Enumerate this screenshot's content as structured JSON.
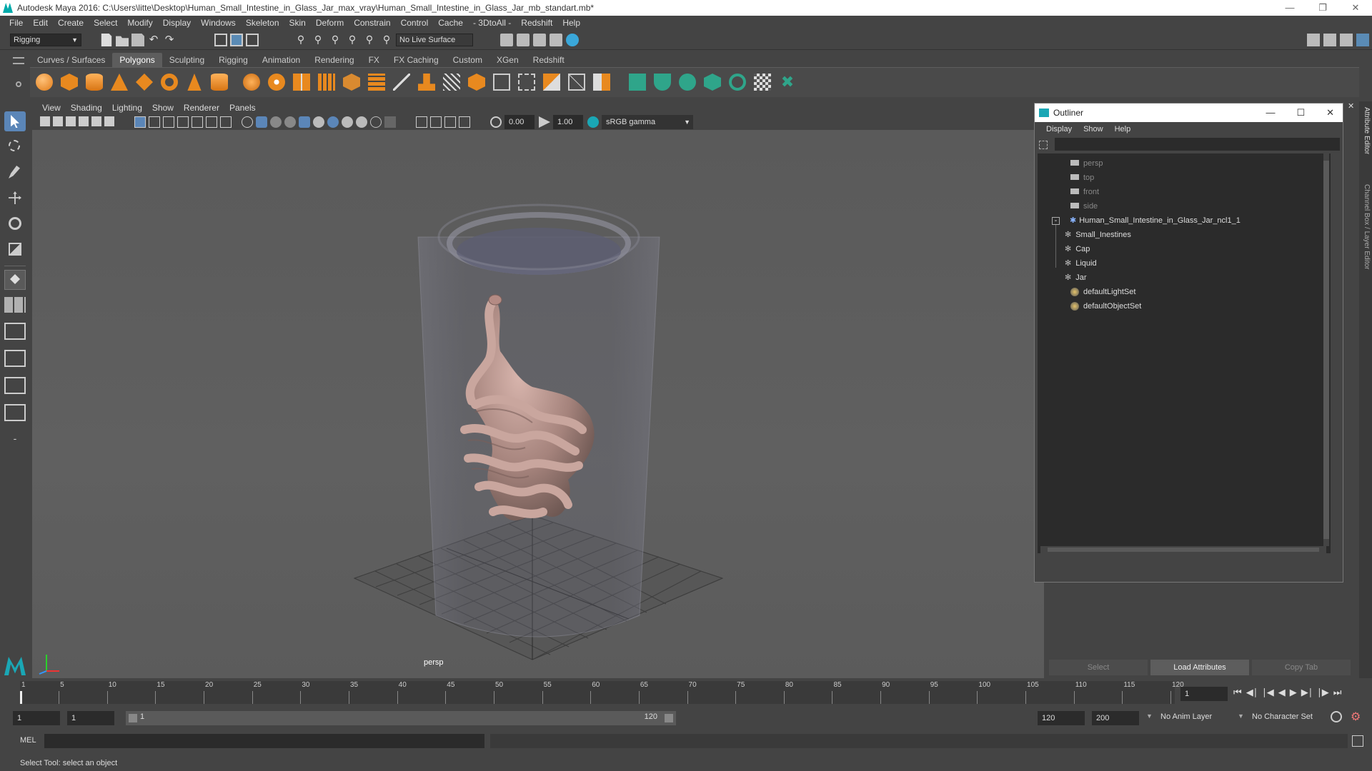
{
  "window": {
    "title": "Autodesk Maya 2016: C:\\Users\\litte\\Desktop\\Human_Small_Intestine_in_Glass_Jar_max_vray\\Human_Small_Intestine_in_Glass_Jar_mb_standart.mb*"
  },
  "menubar": [
    "File",
    "Edit",
    "Create",
    "Select",
    "Modify",
    "Display",
    "Windows",
    "Skeleton",
    "Skin",
    "Deform",
    "Constrain",
    "Control",
    "Cache",
    "- 3DtoAll -",
    "Redshift",
    "Help"
  ],
  "statusline": {
    "mode": "Rigging",
    "live_surface": "No Live Surface"
  },
  "shelf": {
    "tabs": [
      "Curves / Surfaces",
      "Polygons",
      "Sculpting",
      "Rigging",
      "Animation",
      "Rendering",
      "FX",
      "FX Caching",
      "Custom",
      "XGen",
      "Redshift"
    ],
    "active_tab": "Polygons"
  },
  "viewport": {
    "menu": [
      "View",
      "Shading",
      "Lighting",
      "Show",
      "Renderer",
      "Panels"
    ],
    "exposure": "0.00",
    "gamma": "1.00",
    "color_space": "sRGB gamma",
    "camera_label": "persp"
  },
  "outliner": {
    "title": "Outliner",
    "menu": [
      "Display",
      "Show",
      "Help"
    ],
    "items": [
      {
        "label": "persp",
        "type": "camera"
      },
      {
        "label": "top",
        "type": "camera"
      },
      {
        "label": "front",
        "type": "camera"
      },
      {
        "label": "side",
        "type": "camera"
      },
      {
        "label": "Human_Small_Intestine_in_Glass_Jar_ncl1_1",
        "type": "group"
      },
      {
        "label": "Small_Inestines",
        "type": "mesh"
      },
      {
        "label": "Cap",
        "type": "mesh"
      },
      {
        "label": "Liquid",
        "type": "mesh"
      },
      {
        "label": "Jar",
        "type": "mesh"
      },
      {
        "label": "defaultLightSet",
        "type": "set"
      },
      {
        "label": "defaultObjectSet",
        "type": "set"
      }
    ]
  },
  "attr_buttons": {
    "select": "Select",
    "load": "Load Attributes",
    "copy": "Copy Tab"
  },
  "side_tabs": {
    "attr": "Attribute Editor",
    "channel": "Channel Box / Layer Editor"
  },
  "timeline": {
    "ticks": [
      "1",
      "5",
      "10",
      "15",
      "20",
      "25",
      "30",
      "35",
      "40",
      "45",
      "50",
      "55",
      "60",
      "65",
      "70",
      "75",
      "80",
      "85",
      "90",
      "95",
      "100",
      "105",
      "110",
      "115",
      "120"
    ],
    "current_frame": "1"
  },
  "range": {
    "start": "1",
    "current": "1",
    "slider_start": "1",
    "slider_end": "120",
    "end": "120",
    "max_end": "200",
    "anim_layer": "No Anim Layer",
    "char_set": "No Character Set"
  },
  "cmdline": {
    "lang": "MEL"
  },
  "helpline": {
    "text": "Select Tool: select an object"
  }
}
